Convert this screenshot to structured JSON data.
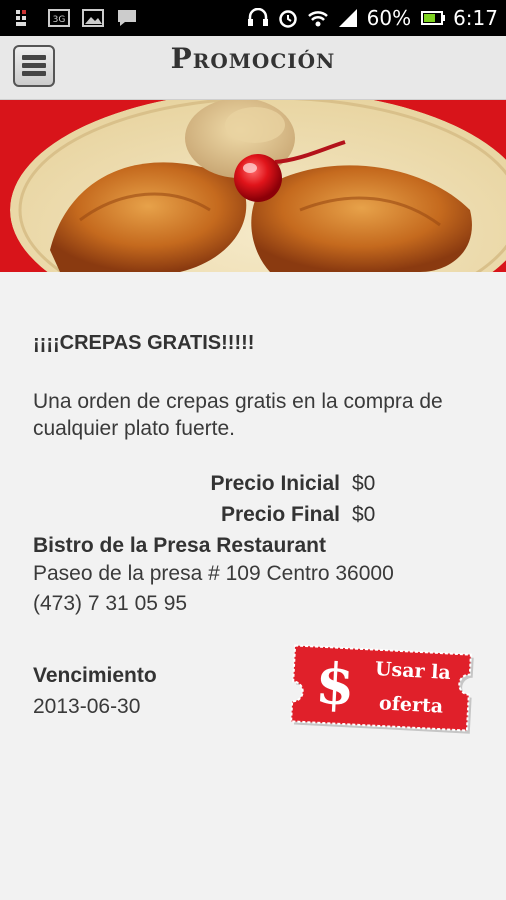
{
  "status_bar": {
    "battery": "60%",
    "time": "6:17",
    "icons": [
      "sim-icon",
      "3g-icon",
      "picture-icon",
      "chat-icon",
      "headset-icon",
      "alarm-icon",
      "wifi-icon",
      "signal-icon",
      "battery-icon"
    ]
  },
  "action_bar": {
    "title": "Promoción",
    "menu_icon": "hamburger-menu-icon"
  },
  "promo": {
    "headline": "¡¡¡¡CREPAS GRATIS!!!!!",
    "description": "Una orden de crepas gratis en la compra de cualquier plato fuerte.",
    "initial_price_label": "Precio Inicial",
    "initial_price_value": "$0",
    "final_price_label": "Precio Final",
    "final_price_value": "$0",
    "business_name": "Bistro de la Presa Restaurant",
    "address": "Paseo de la presa # 109 Centro 36000",
    "phone": "(473) 7 31 05 95",
    "expiration_label": "Vencimiento",
    "expiration_date": "2013-06-30"
  },
  "offer_button": {
    "symbol": "$",
    "line1": "Usar la",
    "line2": "oferta"
  },
  "colors": {
    "accent_red": "#e0202a",
    "status_bar": "#000000",
    "action_bar": "#e8e8e8",
    "background": "#f2f2f2"
  }
}
